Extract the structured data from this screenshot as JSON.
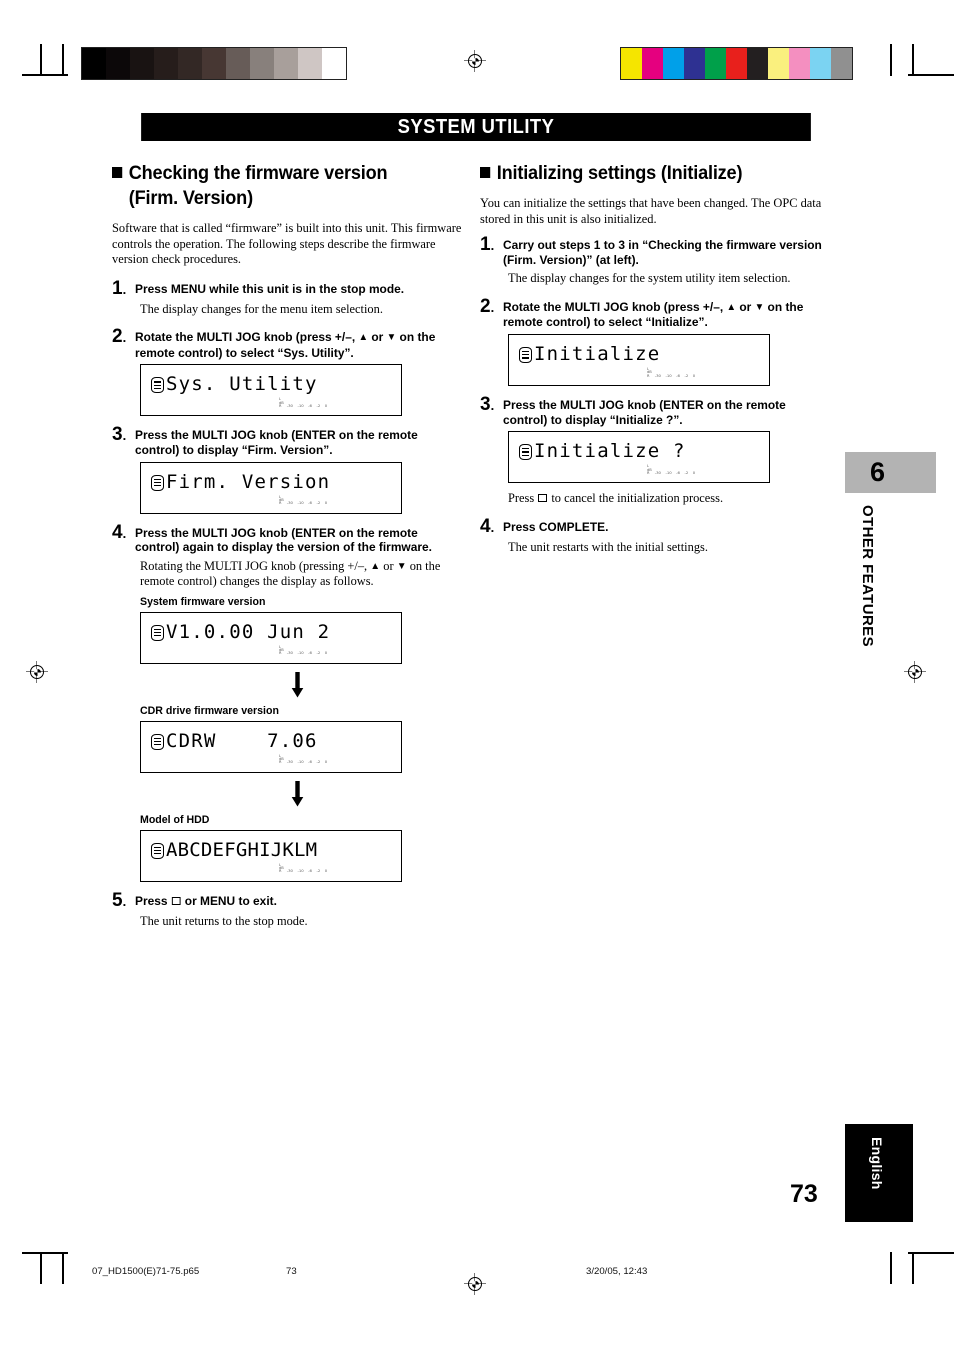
{
  "banner": {
    "title": "SYSTEM UTILITY"
  },
  "left": {
    "heading_line1": "Checking the firmware version",
    "heading_line2": "(Firm. Version)",
    "intro": "Software that is called “firmware” is built into this unit. This firmware controls the operation. The following steps describe the firmware version check procedures.",
    "steps": [
      {
        "num": "1",
        "text": "Press MENU while this unit is in the stop mode.",
        "sub": "The display changes for the menu item selection."
      },
      {
        "num": "2",
        "text_a": "Rotate the MULTI JOG knob (press +/–, ",
        "text_b": " or ",
        "text_c": " on the remote control) to select “Sys. Utility”."
      },
      {
        "num": "3",
        "text": "Press the MULTI JOG knob (ENTER on the remote control) to display “Firm. Version”."
      },
      {
        "num": "4",
        "text": "Press the MULTI JOG knob (ENTER on the remote control) again to display the version of the firmware.",
        "sub_a": "Rotating the MULTI JOG knob (pressing +/–, ",
        "sub_b": " or ",
        "sub_c": " on the remote control) changes the display as follows."
      },
      {
        "num": "5",
        "text_a": "Press ",
        "text_b": " or MENU to exit.",
        "sub": "The unit returns to the stop mode."
      }
    ],
    "displays": {
      "sys_utility": "Sys. Utility",
      "firm_version": "Firm. Version",
      "system_fw": "V1.0.00 Jun 2",
      "cdr_fw": "CDRW    7.06",
      "hdd_model": "ABCDEFGHIJKLM"
    },
    "captions": {
      "system_fw": "System firmware version",
      "cdr_fw": "CDR drive firmware version",
      "hdd_model": "Model of HDD"
    }
  },
  "right": {
    "heading": "Initializing settings (Initialize)",
    "intro": "You can initialize the settings that have been changed. The OPC data stored in this unit is also initialized.",
    "steps": [
      {
        "num": "1",
        "text": "Carry out steps 1 to 3 in “Checking the firmware version (Firm. Version)” (at left).",
        "sub": "The display changes for the system utility item selection."
      },
      {
        "num": "2",
        "text_a": "Rotate the MULTI JOG knob (press +/–, ",
        "text_b": " or ",
        "text_c": " on the remote control) to select “Initialize”."
      },
      {
        "num": "3",
        "text": "Press the MULTI JOG knob (ENTER on the remote control) to display “Initialize ?”.",
        "sub_a": "Press ",
        "sub_b": " to cancel the initialization process."
      },
      {
        "num": "4",
        "text": "Press COMPLETE.",
        "sub": "The unit restarts with the initial settings."
      }
    ],
    "displays": {
      "initialize": "Initialize",
      "initialize_q": "Initialize ?"
    }
  },
  "lcd_meter": {
    "label_l": "L",
    "label_db": "dB",
    "label_r": "R",
    "ticks": [
      "-30",
      "-10",
      "-6",
      "-2",
      "0"
    ]
  },
  "chapter": {
    "number": "6",
    "label": "OTHER FEATURES"
  },
  "language_tab": {
    "label": "English"
  },
  "page_number": "73",
  "footer": {
    "file": "07_HD1500(E)71-75.p65",
    "page": "73",
    "date": "3/20/05, 12:43"
  },
  "calibration": {
    "grayscale": [
      "#000000",
      "#0c0809",
      "#191312",
      "#261d1b",
      "#332825",
      "#473733",
      "#675c58",
      "#88807c",
      "#a89f9b",
      "#cfc6c4",
      "#ffffff"
    ],
    "colorbars": [
      "#f5e500",
      "#e5007f",
      "#00a0e9",
      "#2e3192",
      "#00a04a",
      "#e8201c",
      "#231f20",
      "#faf07e",
      "#f48fc0",
      "#7bd3f2",
      "#909090"
    ]
  }
}
